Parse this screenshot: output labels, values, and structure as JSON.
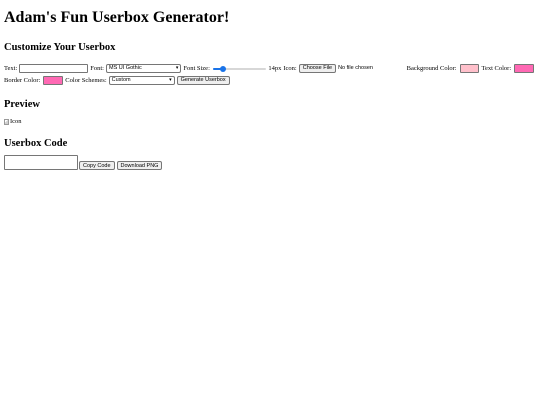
{
  "page": {
    "title": "Adam's Fun Userbox Generator!"
  },
  "customize": {
    "heading": "Customize Your Userbox",
    "text_label": "Text:",
    "text_value": "",
    "font_label": "Font:",
    "font_selected": "MS UI Gothic",
    "font_size_label": "Font Size:",
    "font_size_value": 14,
    "font_size_range": [
      8,
      40
    ],
    "font_size_display": "14px",
    "icon_label": "Icon:",
    "choose_file_label": "Choose File",
    "file_status": "No file chosen",
    "bg_label": "Background Color:",
    "bg_color": "#ffc0cb",
    "text_color_label": "Text Color:",
    "text_color": "#ff69b4",
    "border_label": "Border Color:",
    "border_color": "#ff69b4",
    "scheme_label": "Color Schemes:",
    "scheme_selected": "Custom",
    "generate_label": "Generate Userbox"
  },
  "preview": {
    "heading": "Preview",
    "img_alt": "Icon"
  },
  "code": {
    "heading": "Userbox Code",
    "copy_label": "Copy Code",
    "download_label": "Download PNG"
  },
  "colors": {
    "accent": "#1a73e8"
  },
  "icons": {
    "select": "chevron-down-icon",
    "broken_image": "broken-image-icon"
  }
}
